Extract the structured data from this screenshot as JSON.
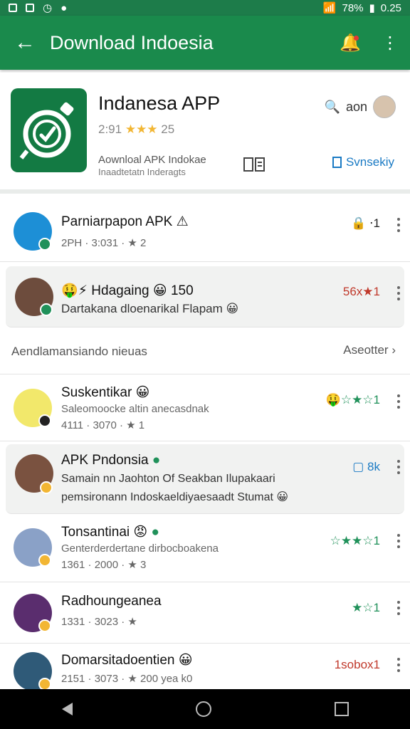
{
  "status_bar": {
    "battery": "78%",
    "time": "0.25"
  },
  "app_bar": {
    "title": "Download Indoesia"
  },
  "app_card": {
    "name": "Indanesa APP",
    "rating_prefix": "2:91",
    "stars": "★★★",
    "rating_suffix": "25",
    "search_text": "aon",
    "desc_line1": "Aownloal APK Indokae",
    "desc_line2": "Inaadtetatn Inderagts",
    "subscribe_label": "Svnsekiy"
  },
  "section": {
    "label": "Aendlamansiando nieuas",
    "more": "Aseotter"
  },
  "items": [
    {
      "title": "Parniarpapon APK",
      "emoji": "⚠",
      "sub": "2PH · 3:031 · ★ 2",
      "right": "⋅1"
    },
    {
      "title": "Hdagaing",
      "emoji": "😀 150",
      "prefix": "🤑⚡",
      "sub": "Dartakana dloenarikal Flapam 😀",
      "right": "56x★1"
    },
    {
      "title": "Suskentikar 😀",
      "sub1": "Saleomoocke altin anecasdnak",
      "sub2": "4111 · 3070 · ★ 1",
      "right": "🤑☆★☆1"
    },
    {
      "title": "APK Pndonsia",
      "sub1": "Samain nn Jaohton Of Seakban Ilupakaari",
      "sub2": "pemsironann Indoskaeldiyaesaadt Stumat 😀",
      "right": "8k"
    },
    {
      "title": "Tonsantinai 😡",
      "sub1": "Genterderdertane dirbocboakena",
      "sub2": "1361 · 2000 · ★ 3",
      "right": "☆★★☆1"
    },
    {
      "title": "Radhoungeanea",
      "sub2": "1331 · 3023 · ★",
      "right": "★☆1"
    },
    {
      "title": "Domarsitadoentien 😀",
      "sub2": "2151 · 3073 · ★ 200 yea k0",
      "right": "1sobox1"
    }
  ]
}
